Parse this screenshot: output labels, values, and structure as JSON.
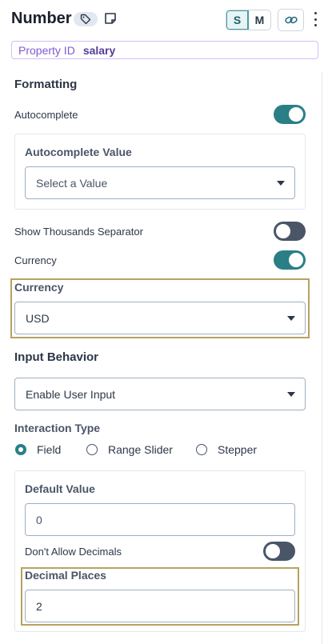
{
  "header": {
    "title": "Number",
    "tag_icon": "tag-icon",
    "note_icon": "note-icon",
    "size_options": [
      "S",
      "M"
    ],
    "selected_size": "S",
    "link_icon": "link-icon",
    "more_icon": "kebab-menu-icon"
  },
  "property": {
    "label": "Property ID",
    "value": "salary"
  },
  "formatting": {
    "heading": "Formatting",
    "autocomplete": {
      "label": "Autocomplete",
      "enabled": true
    },
    "autocomplete_value": {
      "label": "Autocomplete Value",
      "placeholder": "Select a Value"
    },
    "thousands_separator": {
      "label": "Show Thousands Separator",
      "enabled": false
    },
    "currency_toggle": {
      "label": "Currency",
      "enabled": true
    },
    "currency_select": {
      "label": "Currency",
      "value": "USD"
    }
  },
  "input_behavior": {
    "heading": "Input Behavior",
    "value": "Enable User Input"
  },
  "interaction_type": {
    "label": "Interaction Type",
    "options": [
      "Field",
      "Range Slider",
      "Stepper"
    ],
    "selected": "Field"
  },
  "field_settings": {
    "default_value": {
      "label": "Default Value",
      "value": "0"
    },
    "no_decimals": {
      "label": "Don't Allow Decimals",
      "enabled": false
    },
    "decimal_places": {
      "label": "Decimal Places",
      "value": "2"
    }
  },
  "colors": {
    "accent": "#2a7f87",
    "highlight": "#b7a260",
    "purple": "#805ad5"
  }
}
